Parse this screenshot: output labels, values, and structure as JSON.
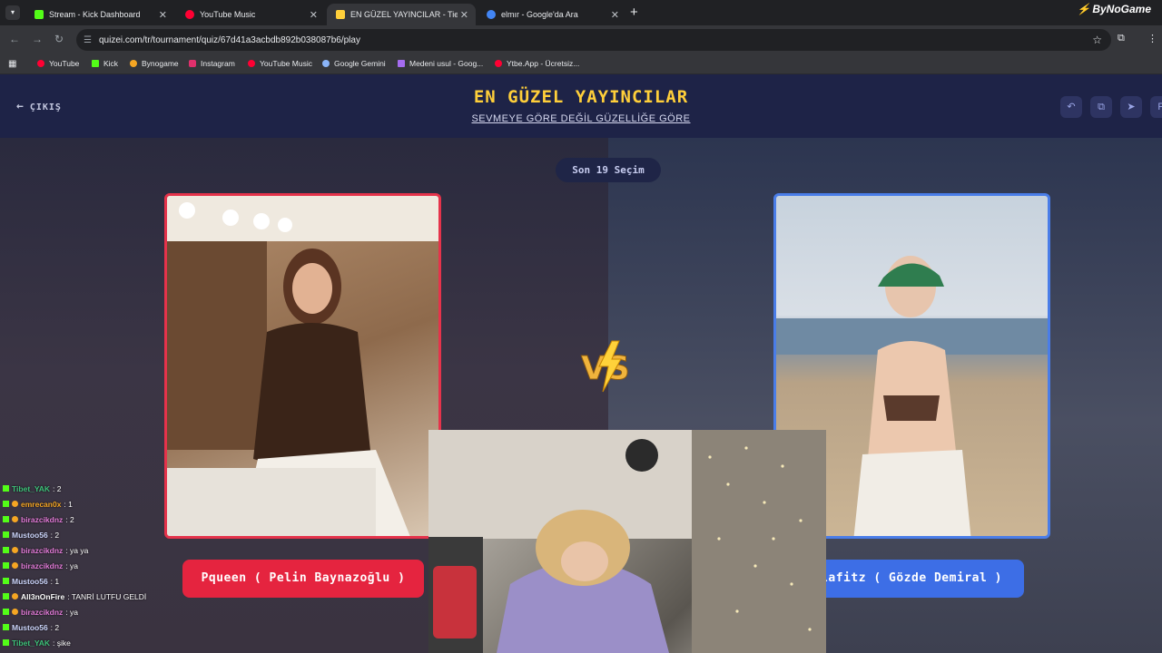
{
  "browser": {
    "tabs": [
      {
        "label": "Stream - Kick Dashboard",
        "icon": "kick-icon",
        "color": "#53fc18"
      },
      {
        "label": "YouTube Music",
        "icon": "youtube-music-icon",
        "color": "#ff0033"
      },
      {
        "label": "EN GÜZEL YAYINCILAR - Tier Li",
        "icon": "quizei-icon",
        "color": "#ffcf3a"
      },
      {
        "label": "elmır - Google'da Ara",
        "icon": "google-icon",
        "color": "#4285f4"
      }
    ],
    "brand": "ByNoGame",
    "url": "quizei.com/tr/tournament/quiz/67d41a3acbdb892b038087b6/play",
    "bookmarks": [
      {
        "label": "YouTube",
        "color": "#ff0033"
      },
      {
        "label": "Kick",
        "color": "#53fc18"
      },
      {
        "label": "Bynogame",
        "color": "#f5a623"
      },
      {
        "label": "Instagram",
        "color": "#e1306c"
      },
      {
        "label": "YouTube Music",
        "color": "#ff0033"
      },
      {
        "label": "Google Gemini",
        "color": "#8ab4f8"
      },
      {
        "label": "Medeni usul - Goog...",
        "color": "#a56cf0"
      },
      {
        "label": "Ytbe.App - Ücretsiz...",
        "color": "#ff0033"
      }
    ]
  },
  "quiz": {
    "exit_label": "ÇIKIŞ",
    "title": "EN GÜZEL YAYINCILAR",
    "subtitle": "SEVMEYE GÖRE DEĞİL GÜZELLİĞE GÖRE",
    "counter": "Son 19 Seçim",
    "left_name": "Pqueen ( Pelin Baynazoğlu )",
    "right_name": "lafitz ( Gözde Demiral )",
    "vs_label": "VS"
  },
  "chat": [
    {
      "user": "Tibet_YAK",
      "msg": ": 2",
      "color": "#3ec27a"
    },
    {
      "user": "emrecan0x",
      "msg": ": 1",
      "color": "#f5a623"
    },
    {
      "user": "birazcikdnz",
      "msg": ": 2",
      "color": "#e07ad6"
    },
    {
      "user": "Mustoo56",
      "msg": ": 2",
      "color": "#cfd8ff"
    },
    {
      "user": "birazcikdnz",
      "msg": ": ya ya",
      "color": "#e07ad6"
    },
    {
      "user": "birazcikdnz",
      "msg": ": ya",
      "color": "#e07ad6"
    },
    {
      "user": "Mustoo56",
      "msg": ": 1",
      "color": "#cfd8ff"
    },
    {
      "user": "All3nOnFire",
      "msg": ": TANRİ LUTFU GELDİ",
      "color": "#ffffff"
    },
    {
      "user": "birazcikdnz",
      "msg": ": ya",
      "color": "#e07ad6"
    },
    {
      "user": "Mustoo56",
      "msg": ": 2",
      "color": "#cfd8ff"
    },
    {
      "user": "Tibet_YAK",
      "msg": ": şike",
      "color": "#3ec27a"
    }
  ]
}
